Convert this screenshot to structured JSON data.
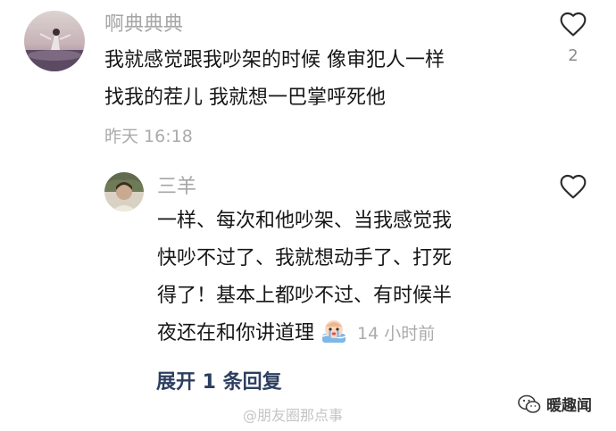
{
  "comments": [
    {
      "username": "啊典典典",
      "lines": [
        "我就感觉跟我吵架的时候 像审犯人一样",
        "找我的茬儿 我就想一巴掌呼死他"
      ],
      "time": "昨天 16:18",
      "like_count": "2",
      "avatar_icon": "user-avatar-photo"
    }
  ],
  "reply": {
    "username": "三羊",
    "lines": [
      "一样、每次和他吵架、当我感觉我",
      "快吵不过了、我就想动手了、打死",
      "得了！基本上都吵不过、有时候半",
      "夜还在和你讲道理"
    ],
    "emoji_icon": "crying-emoji-icon",
    "time": "14 小时前",
    "avatar_icon": "user-avatar-photo"
  },
  "expand_label": "展开 1 条回复",
  "watermark": {
    "weibo": "@朋友圈那点事",
    "brand": "暖趣闻"
  },
  "colors": {
    "username": "#a6a6a6",
    "text": "#161616",
    "meta": "#ababab",
    "expand": "#2c3f60"
  }
}
